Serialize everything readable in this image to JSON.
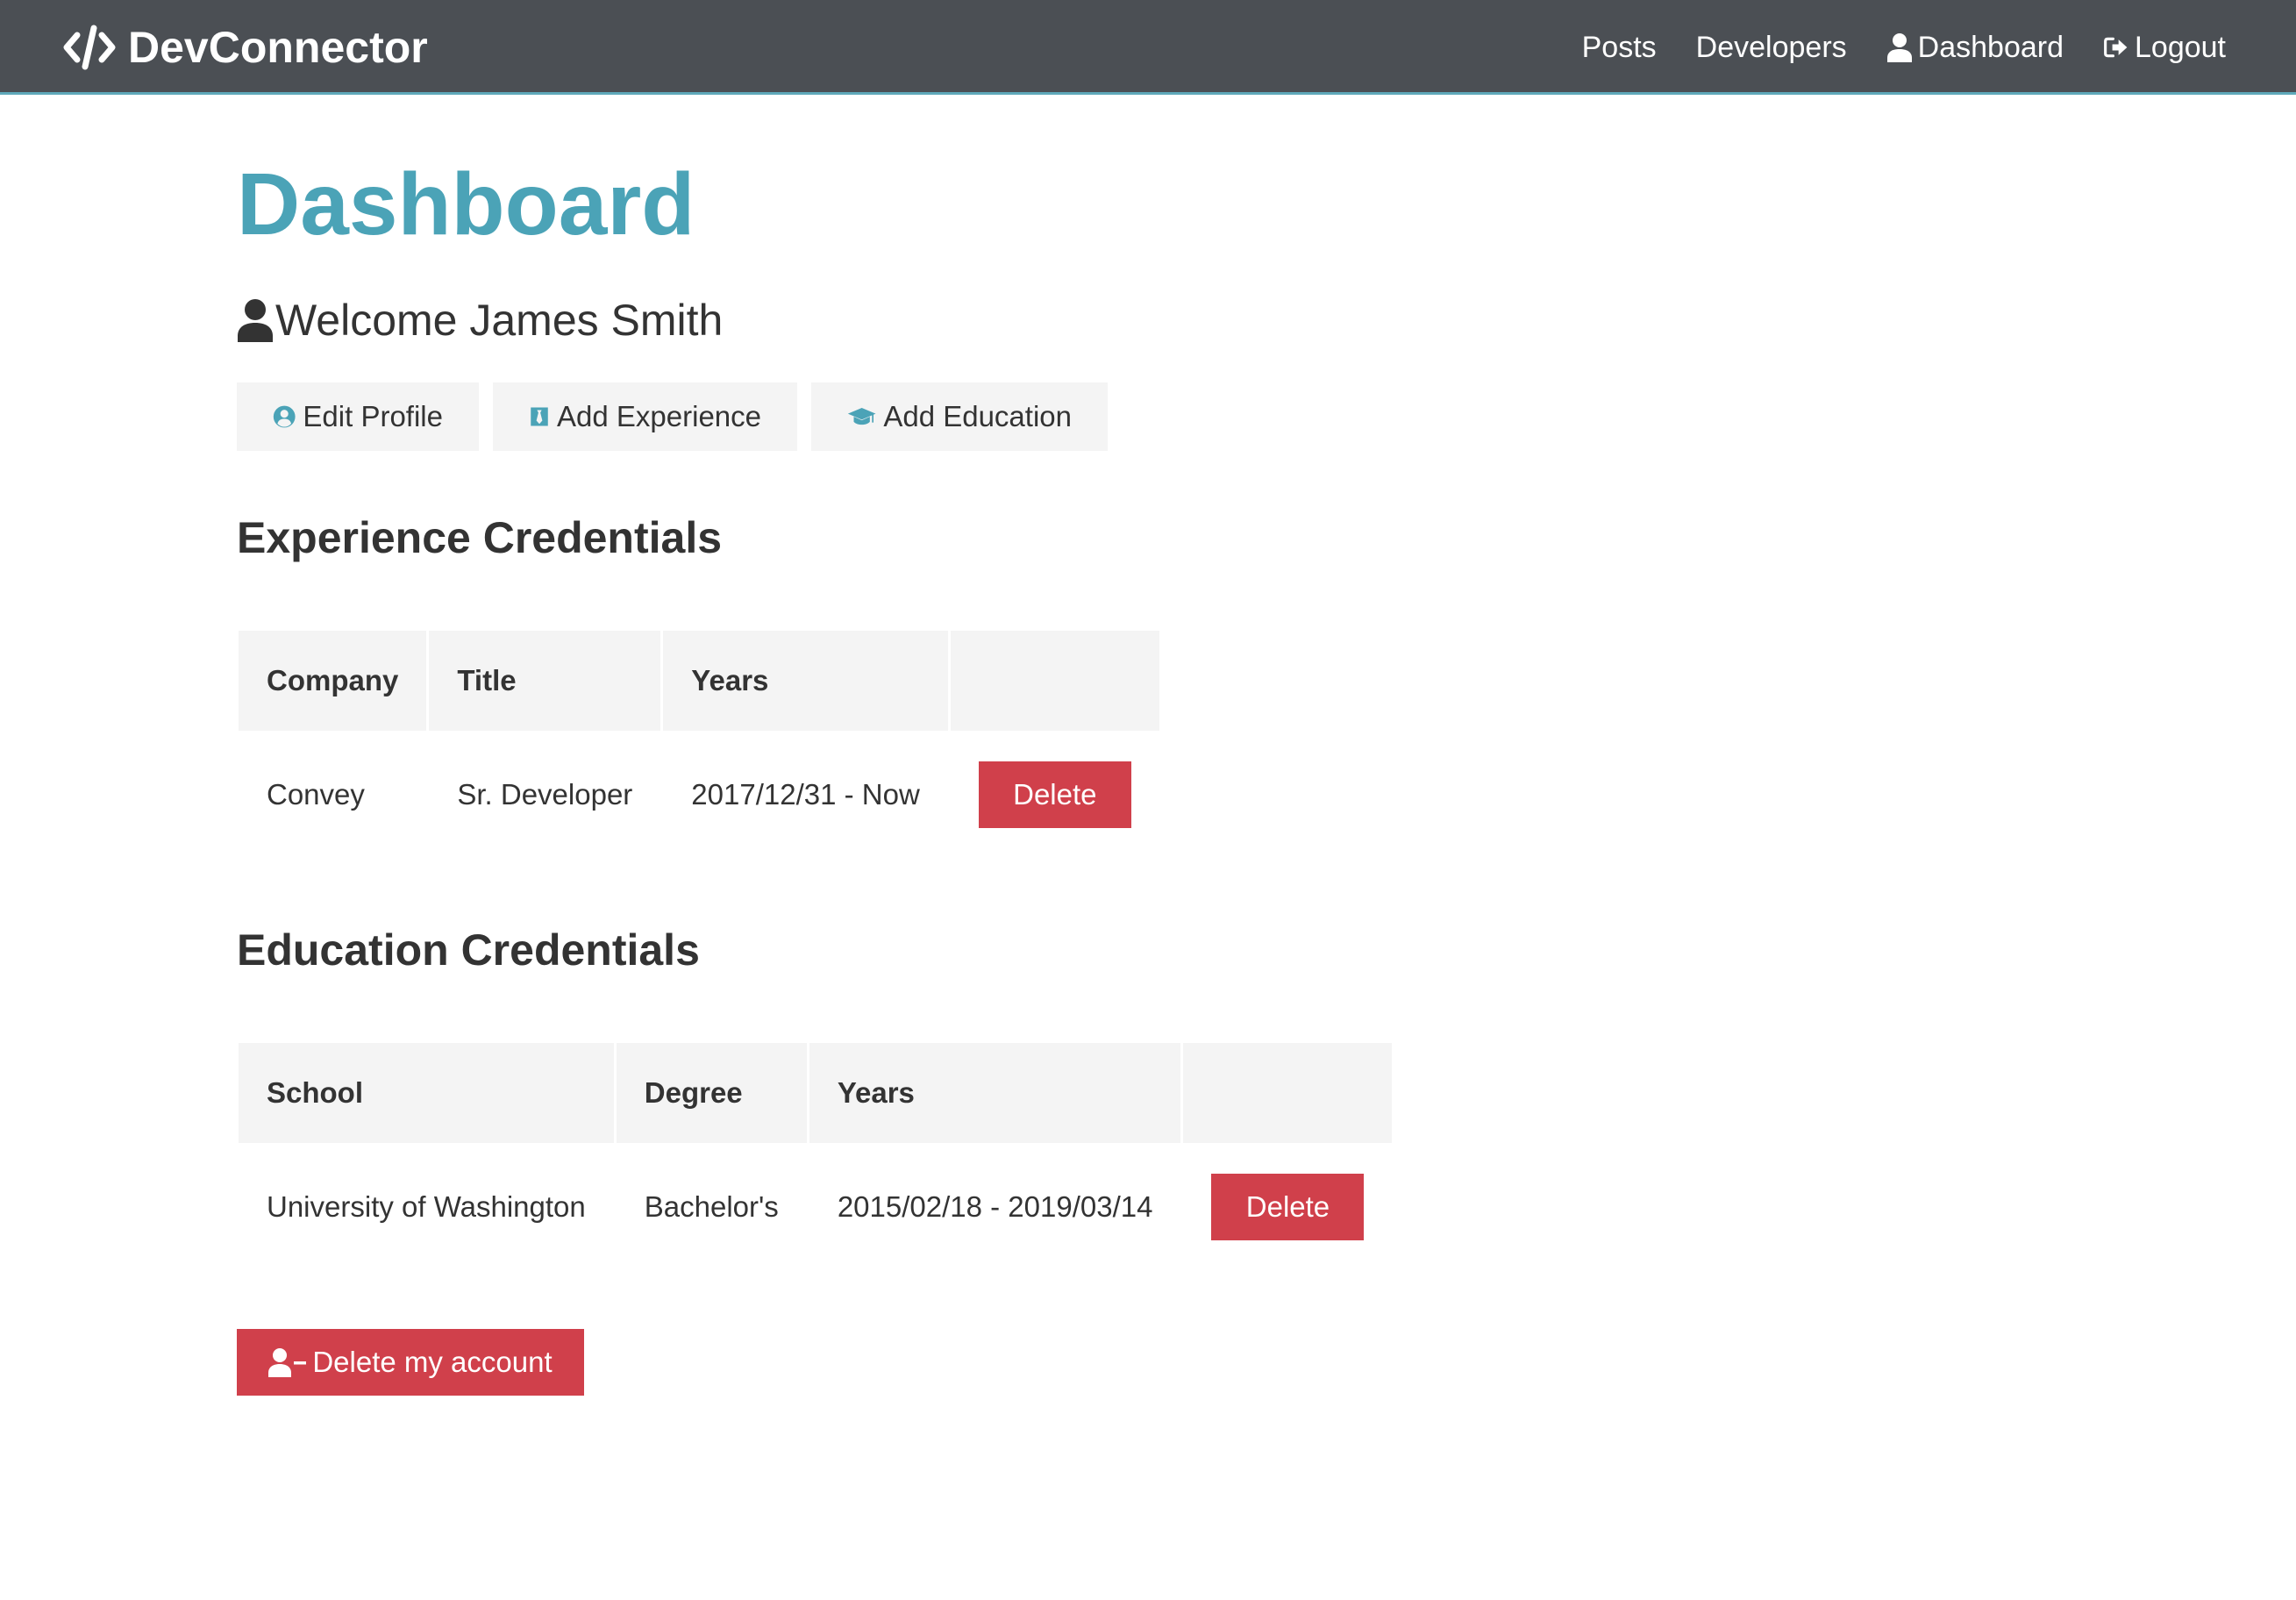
{
  "navbar": {
    "brand": "DevConnector",
    "brand_icon": "code-icon",
    "links": [
      {
        "label": "Posts",
        "icon": ""
      },
      {
        "label": "Developers",
        "icon": ""
      },
      {
        "label": "Dashboard",
        "icon": "user-icon"
      },
      {
        "label": "Logout",
        "icon": "sign-out-icon"
      }
    ]
  },
  "page": {
    "title": "Dashboard",
    "welcome": "Welcome James Smith"
  },
  "actions": {
    "edit_profile": "Edit Profile",
    "add_experience": "Add Experience",
    "add_education": "Add Education"
  },
  "experience": {
    "title": "Experience Credentials",
    "headers": [
      "Company",
      "Title",
      "Years"
    ],
    "rows": [
      {
        "company": "Convey",
        "title": "Sr. Developer",
        "years": "2017/12/31 - Now",
        "delete_label": "Delete"
      }
    ]
  },
  "education": {
    "title": "Education Credentials",
    "headers": [
      "School",
      "Degree",
      "Years"
    ],
    "rows": [
      {
        "school": "University of Washington",
        "degree": "Bachelor's",
        "years": "2015/02/18 - 2019/03/14",
        "delete_label": "Delete"
      }
    ]
  },
  "delete_account": {
    "label": "Delete my account",
    "icon": "user-minus-icon"
  },
  "colors": {
    "navbar_bg": "#4b4f54",
    "accent": "#4ba3b7",
    "danger": "#d0404b",
    "light": "#f4f4f4",
    "text": "#333333"
  }
}
